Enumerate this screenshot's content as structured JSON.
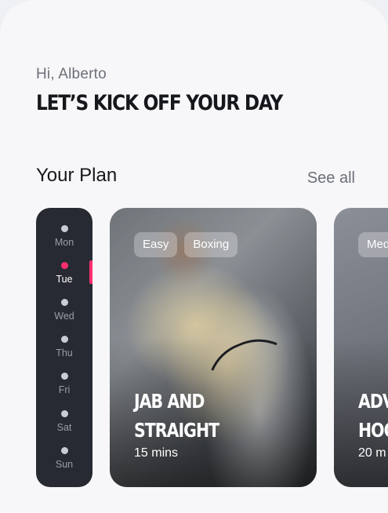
{
  "greeting": "Hi, Alberto",
  "headline": "LET’S KICK OFF YOUR DAY",
  "plan": {
    "title": "Your Plan",
    "see_all": "See all"
  },
  "days": [
    {
      "label": "Mon",
      "active": false
    },
    {
      "label": "Tue",
      "active": true
    },
    {
      "label": "Wed",
      "active": false
    },
    {
      "label": "Thu",
      "active": false
    },
    {
      "label": "Fri",
      "active": false
    },
    {
      "label": "Sat",
      "active": false
    },
    {
      "label": "Sun",
      "active": false
    }
  ],
  "cards": [
    {
      "tags": [
        "Easy",
        "Boxing"
      ],
      "title_lines": [
        "JAB AND",
        "STRAIGHT"
      ],
      "duration": "15 mins"
    },
    {
      "tags": [
        "Med"
      ],
      "title_lines": [
        "ADV",
        "HOO"
      ],
      "duration": "20 m"
    }
  ],
  "colors": {
    "accent": "#ff2e6e",
    "day_panel": "#272a33",
    "background": "#f7f7f9",
    "text_primary": "#15171c",
    "text_secondary": "#6b6f78"
  }
}
